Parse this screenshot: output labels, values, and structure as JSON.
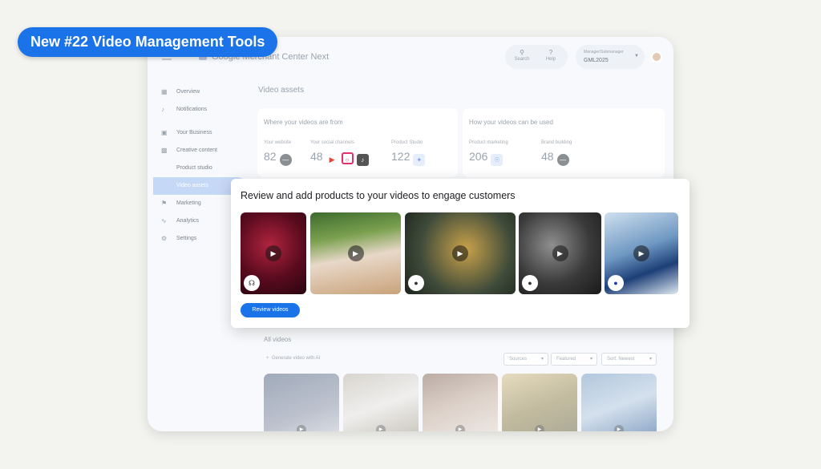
{
  "badge": "New #22  Video Management Tools",
  "topbar": {
    "brand": "Google Merchant Center Next",
    "search_label": "Search",
    "help_label": "Help",
    "account_role": "Manager/Submanager",
    "account_name": "GML2025"
  },
  "nav": [
    {
      "label": "Overview",
      "icon": "grid-icon"
    },
    {
      "label": "Notifications",
      "icon": "bell-icon"
    },
    {
      "label": "Your Business",
      "icon": "store-icon"
    },
    {
      "label": "Creative content",
      "icon": "image-icon"
    },
    {
      "label": "Product studio",
      "icon": ""
    },
    {
      "label": "Video assets",
      "icon": "",
      "active": true
    },
    {
      "label": "Marketing",
      "icon": "megaphone-icon"
    },
    {
      "label": "Analytics",
      "icon": "trend-icon"
    },
    {
      "label": "Settings",
      "icon": "gear-icon"
    }
  ],
  "main": {
    "title": "Video assets",
    "sources_card": {
      "title": "Where your videos are from",
      "stats": [
        {
          "label": "Your website",
          "value": "82"
        },
        {
          "label": "Your social channels",
          "value": "48"
        },
        {
          "label": "Product Studio",
          "value": "122"
        }
      ]
    },
    "usage_card": {
      "title": "How your videos can be used",
      "stats": [
        {
          "label": "Product marketing",
          "value": "206"
        },
        {
          "label": "Brand building",
          "value": "48"
        }
      ]
    },
    "all_videos": {
      "title": "All videos",
      "generate": "Generate video with AI",
      "filters": [
        "Sources",
        "Featured",
        "Sort: Newest"
      ]
    }
  },
  "popup": {
    "title": "Review and add products to your videos to engage customers",
    "button": "Review videos"
  },
  "colors": {
    "accent": "#1a73e8"
  }
}
